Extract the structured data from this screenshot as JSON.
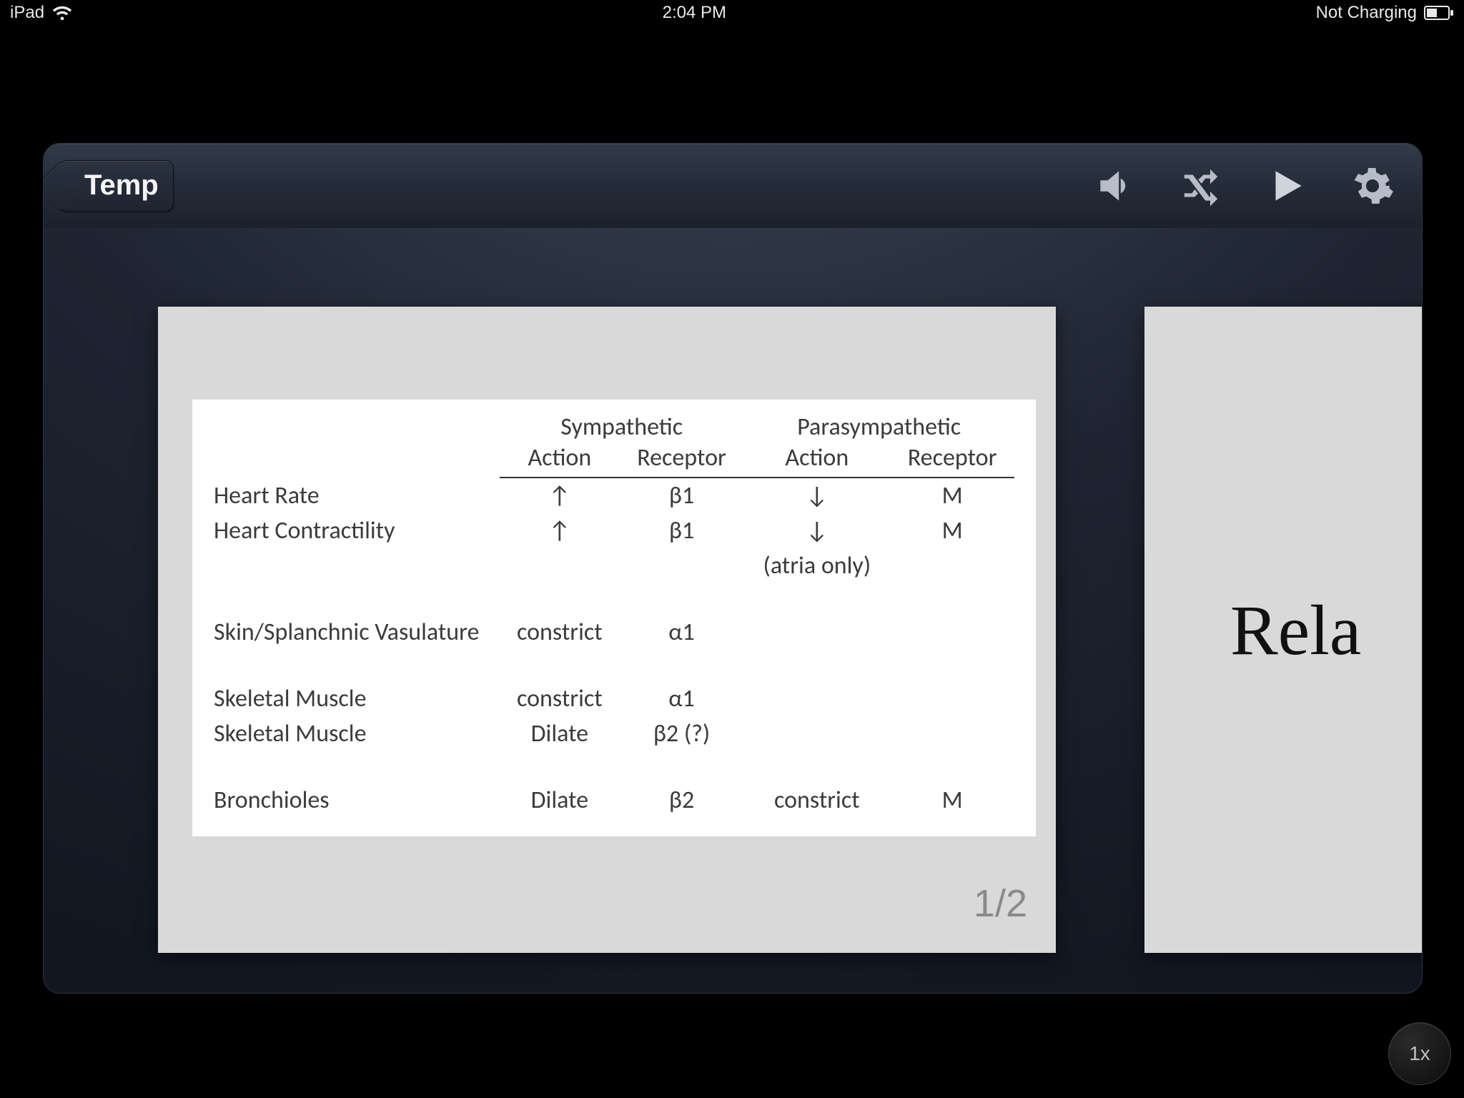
{
  "status_bar": {
    "device": "iPad",
    "time": "2:04 PM",
    "charging_text": "Not Charging"
  },
  "toolbar": {
    "back_label": "Temp",
    "icons": {
      "audio": "speaker-icon",
      "shuffle": "shuffle-icon",
      "play": "play-icon",
      "settings": "gear-icon"
    }
  },
  "card": {
    "page_indicator": "1/2",
    "table": {
      "group_headers": [
        "",
        "Sympathetic",
        "Parasympathetic"
      ],
      "sub_headers": [
        "Action",
        "Receptor",
        "Action",
        "Receptor"
      ],
      "rows": [
        {
          "label": "Heart Rate",
          "sym_action": "↑",
          "sym_receptor": "β1",
          "para_action": "↓",
          "para_receptor": "M"
        },
        {
          "label": "Heart Contractility",
          "sym_action": "↑",
          "sym_receptor": "β1",
          "para_action": "↓",
          "para_receptor": "M",
          "note_below_para_action": "(atria only)"
        },
        {
          "spacer": true
        },
        {
          "label": "Skin/Splanchnic Vasulature",
          "sym_action": "constrict",
          "sym_receptor": "α1",
          "para_action": "",
          "para_receptor": ""
        },
        {
          "spacer": true
        },
        {
          "label": "Skeletal Muscle",
          "sym_action": "constrict",
          "sym_receptor": "α1",
          "para_action": "",
          "para_receptor": ""
        },
        {
          "label": "Skeletal Muscle",
          "sym_action": "Dilate",
          "sym_receptor": "β2 (?)",
          "para_action": "",
          "para_receptor": ""
        },
        {
          "spacer": true
        },
        {
          "label": "Bronchioles",
          "sym_action": "Dilate",
          "sym_receptor": "β2",
          "para_action": "constrict",
          "para_receptor": "M"
        }
      ]
    }
  },
  "peek_card": {
    "text_fragment": "Rela"
  },
  "scale_badge": "1x"
}
